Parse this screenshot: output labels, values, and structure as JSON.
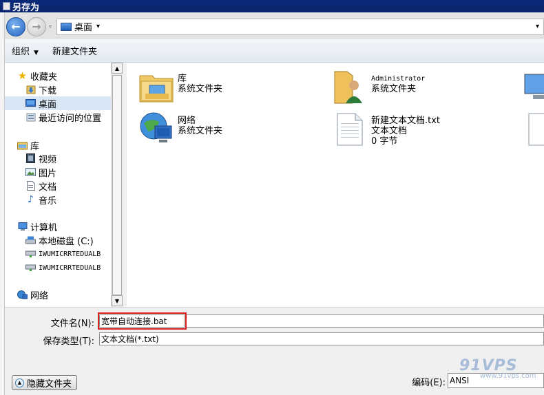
{
  "window": {
    "title": "另存为"
  },
  "address": {
    "location": "桌面",
    "location_caret": "▾",
    "drop_caret": "▾",
    "fwd_drop_caret": "▿"
  },
  "toolbar": {
    "organize_label": "组织",
    "organize_caret": "▼",
    "new_folder_label": "新建文件夹"
  },
  "navigation": {
    "favorites": {
      "label": "收藏夹",
      "icon": "star-icon"
    },
    "favorites_items": [
      {
        "label": "下载",
        "icon": "download-folder-icon"
      },
      {
        "label": "桌面",
        "icon": "desktop-icon",
        "selected": true
      },
      {
        "label": "最近访问的位置",
        "icon": "recent-places-icon"
      }
    ],
    "libraries": {
      "label": "库",
      "icon": "library-icon"
    },
    "library_items": [
      {
        "label": "视频",
        "icon": "video-icon"
      },
      {
        "label": "图片",
        "icon": "picture-icon"
      },
      {
        "label": "文档",
        "icon": "document-icon"
      },
      {
        "label": "音乐",
        "icon": "music-icon"
      }
    ],
    "computer": {
      "label": "计算机",
      "icon": "computer-icon"
    },
    "computer_items": [
      {
        "label": "本地磁盘 (C:)",
        "icon": "local-disk-icon"
      },
      {
        "label": "IWUMICRRTEDUALB",
        "icon": "network-drive-icon"
      },
      {
        "label": "IWUMICRRTEDUALB",
        "icon": "network-drive-icon"
      }
    ],
    "network": {
      "label": "网络",
      "icon": "network-icon"
    }
  },
  "files": [
    {
      "name": "库",
      "type": "系统文件夹",
      "icon": "library-folder-icon"
    },
    {
      "name": "Administrator",
      "type": "系统文件夹",
      "icon": "user-folder-icon"
    },
    {
      "name": "网络",
      "type": "系统文件夹",
      "icon": "network-globe-icon"
    },
    {
      "name": "新建文本文档.txt",
      "type": "文本文档",
      "size": "0 字节",
      "icon": "text-file-icon"
    }
  ],
  "form": {
    "filename_label": "文件名(N):",
    "filename_value": "宽带自动连接.bat",
    "filetype_label": "保存类型(T):",
    "filetype_value": "文本文档(*.txt)",
    "encoding_label": "编码(E):",
    "encoding_value": "ANSI",
    "hide_folders_label": "隐藏文件夹",
    "hide_folders_caret": "▲"
  },
  "scrollbar": {
    "up_arrow": "▲",
    "down_arrow": "▼"
  },
  "watermark": {
    "brand": "91VPS",
    "site": "www.91vps.com"
  },
  "colors": {
    "title_bar": "#0a246a",
    "highlight_border": "#e02020",
    "selection": "#d9e6f6",
    "watermark": "#9bb3d6"
  }
}
